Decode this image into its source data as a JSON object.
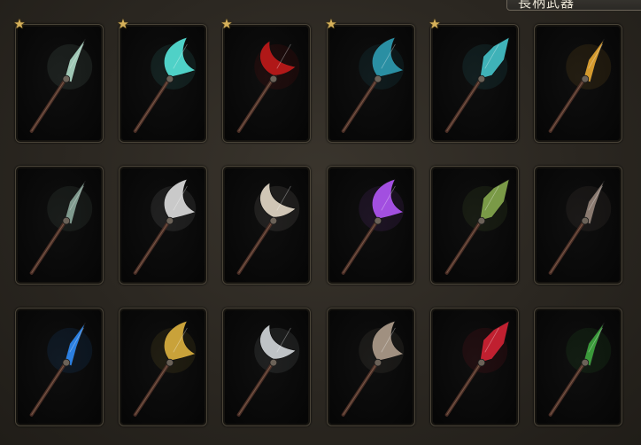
{
  "header": {
    "title": "長柄武器"
  },
  "cards": [
    {
      "icon": "spear-icon",
      "starred": true,
      "color": "#9fc7b5"
    },
    {
      "icon": "cyan-axe-icon",
      "starred": true,
      "color": "#4fd1c7"
    },
    {
      "icon": "red-scythe-icon",
      "starred": true,
      "color": "#b01818"
    },
    {
      "icon": "teal-scythe-icon",
      "starred": true,
      "color": "#2a8fa3"
    },
    {
      "icon": "teal-glaive-icon",
      "starred": true,
      "color": "#3fb2b8"
    },
    {
      "icon": "flame-spear-icon",
      "starred": false,
      "color": "#d49a2e"
    },
    {
      "icon": "crescent-axe-icon",
      "starred": false,
      "color": "#7f9a8e"
    },
    {
      "icon": "silver-glaive-icon",
      "starred": false,
      "color": "#c9c9c9"
    },
    {
      "icon": "bone-scythe-icon",
      "starred": false,
      "color": "#d0c6b6"
    },
    {
      "icon": "purple-halberd-icon",
      "starred": false,
      "color": "#a24fe0"
    },
    {
      "icon": "green-staff-icon",
      "starred": false,
      "color": "#7a9a47"
    },
    {
      "icon": "dark-trident-icon",
      "starred": false,
      "color": "#8a7a70"
    },
    {
      "icon": "blue-claw-scythe-icon",
      "starred": false,
      "color": "#2b7fe0"
    },
    {
      "icon": "gold-claw-scythe-icon",
      "starred": false,
      "color": "#c9a23a"
    },
    {
      "icon": "silver-spear-icon",
      "starred": false,
      "color": "#bfc3c6"
    },
    {
      "icon": "bronze-trident-icon",
      "starred": false,
      "color": "#a09080"
    },
    {
      "icon": "red-blade-icon",
      "starred": false,
      "color": "#c02030"
    },
    {
      "icon": "green-blade-icon",
      "starred": false,
      "color": "#3a9a3a"
    }
  ],
  "star_glyph": "★"
}
